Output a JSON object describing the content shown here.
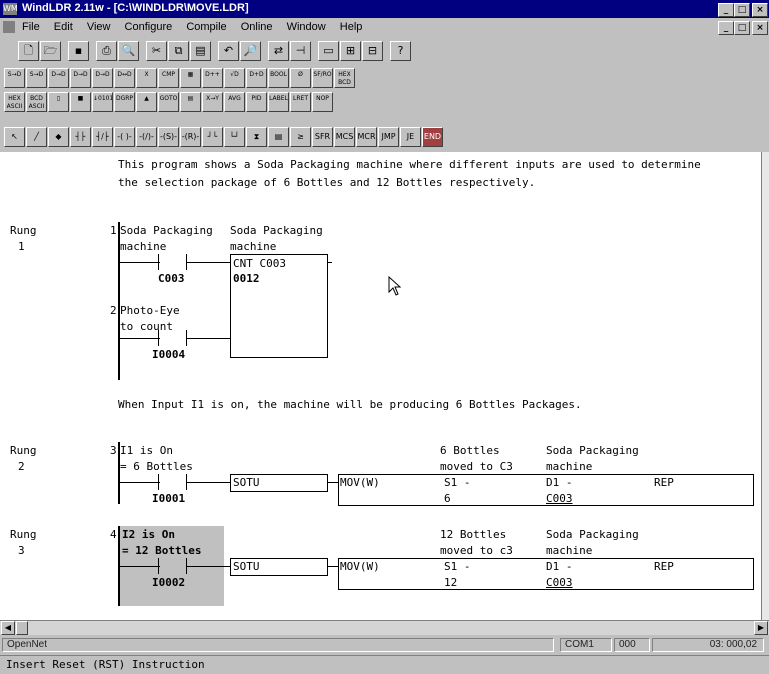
{
  "window": {
    "app_icon": "WM",
    "title": "WindLDR 2.11w - [C:\\WINDLDR\\MOVE.LDR]",
    "controls": [
      "_",
      "□",
      "×"
    ],
    "doc_controls": [
      "_",
      "□",
      "×"
    ]
  },
  "menu": [
    "File",
    "Edit",
    "View",
    "Configure",
    "Compile",
    "Online",
    "Window",
    "Help"
  ],
  "toolbar1": [
    "new-icon",
    "open-icon",
    "save-icon",
    "print-icon",
    "print-preview-icon",
    "cut-icon",
    "copy-icon",
    "paste-icon",
    "undo-icon",
    "find-icon",
    "replace-icon",
    "goto-rung-icon",
    "window-icon",
    "monitor-icon",
    "transfer-icon",
    "help-icon"
  ],
  "toolbar1_glyphs": [
    "🗋",
    "🗁",
    "▪",
    "⎙",
    "🔍",
    "✂",
    "⧉",
    "▤",
    "↶",
    "🔎",
    "⇄",
    "⊣",
    "▭",
    "⊞",
    "⊟",
    "?"
  ],
  "toolbar2": {
    "row1": [
      "S→D",
      "S→D",
      "D→D",
      "D→D",
      "D→D",
      "D↔D",
      "X",
      "CMP",
      "▦",
      "D++",
      "√D",
      "D+D",
      "BOOL",
      "Ø",
      "SF/RO",
      "HEX BCD"
    ],
    "row2": [
      "HEX ASCII",
      "BCD ASCII",
      "▯",
      "■",
      "↓0101",
      "DGRP",
      "▲",
      "GOTO",
      "▤",
      "X→Y",
      "AVG",
      "PID",
      "LABEL",
      "LRET",
      "NOP"
    ]
  },
  "toolbar3": [
    "pointer-icon",
    "line-draw-icon",
    "eraser-icon",
    "no-contact-icon",
    "nc-contact-icon",
    "coil-icon",
    "nc-coil-icon",
    "set-coil-icon",
    "reset-coil-icon",
    "rising-edge-icon",
    "falling-edge-icon",
    "timer-icon",
    "counter-icon",
    "compare-icon",
    "shift-icon",
    "mcs-icon",
    "mcr-icon",
    "jump-icon",
    "jend-icon",
    "end-icon"
  ],
  "toolbar3_glyphs": [
    "↖",
    "╱",
    "◆",
    "┤├",
    "┤/├",
    "-( )-",
    "-(/)-",
    "-(S)-",
    "-(R)-",
    "┘└",
    "└┘",
    "⧗",
    "▤",
    "≥",
    "SFR",
    "MCS",
    "MCR",
    "JMP",
    "JE",
    "END"
  ],
  "comments": {
    "intro_line1": "This program shows a Soda Packaging machine where different inputs are used to determine",
    "intro_line2": "the selection package of 6 Bottles and 12 Bottles respectively.",
    "rung_comment": "When Input I1 is on, the machine will be producing 6 Bottles Packages."
  },
  "rung_label": "Rung",
  "rung_1": {
    "number": "1",
    "line1_index": "1",
    "line2_index": "2",
    "contact1_comment1": "Soda Packaging",
    "contact1_comment2": "machine",
    "contact1_op": "C003",
    "coil_comment1": "Soda Packaging",
    "coil_comment2": "machine",
    "cnt_instr": "CNT C003",
    "cnt_preset": "0012",
    "contact2_comment1": "Photo-Eye",
    "contact2_comment2": "to count",
    "contact2_op": "I0004"
  },
  "rung_2": {
    "number": "2",
    "line_index": "3",
    "contact_comment1": "I1 is On",
    "contact_comment2": "= 6 Bottles",
    "contact_op": "I0001",
    "sotu": "SOTU",
    "mov": "MOV(W)",
    "src_comment1": "6 Bottles",
    "src_comment2": "moved to C3",
    "src_label": "S1 -",
    "src_value": "6",
    "dst_comment1": "Soda Packaging",
    "dst_comment2": "machine",
    "dst_label": "D1 -",
    "dst_value": "C003",
    "rep": "REP"
  },
  "rung_3": {
    "number": "3",
    "line_index": "4",
    "contact_comment1": "I2 is On",
    "contact_comment2": "= 12 Bottles",
    "contact_op": "I0002",
    "sotu": "SOTU",
    "mov": "MOV(W)",
    "src_comment1": "12 Bottles",
    "src_comment2": "moved to c3",
    "src_label": "S1 -",
    "src_value": "12",
    "dst_comment1": "Soda Packaging",
    "dst_comment2": "machine",
    "dst_label": "D1 -",
    "dst_value": "C003",
    "rep": "REP"
  },
  "status_bar": {
    "network": "OpenNet",
    "port": "COM1",
    "station": "000",
    "position": "03: 000,02"
  },
  "prompt": "Insert Reset (RST) Instruction"
}
